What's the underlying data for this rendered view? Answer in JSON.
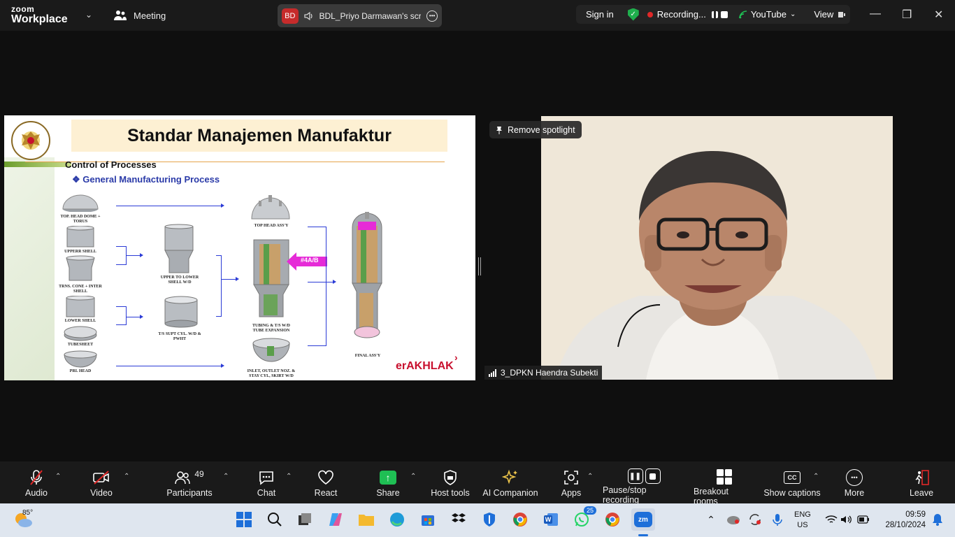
{
  "app": {
    "brand_top": "zoom",
    "brand_bottom": "Workplace"
  },
  "header": {
    "meeting_label": "Meeting",
    "share_initials": "BD",
    "share_name": "BDL_Priyo Darmawan's scree",
    "sign_in": "Sign in",
    "recording": "Recording...",
    "youtube": "YouTube",
    "view": "View"
  },
  "slide": {
    "title": "Standar Manajemen Manufaktur",
    "section": "Control of Processes",
    "subsection": "❖ General Manufacturing Process",
    "parts": {
      "top_head": "TOP. HEAD DOME + TORUS",
      "upper_shell": "UPPERR SHELL",
      "trns_cone": "TRNS. CONE + INTER SHELL",
      "lower_shell": "LOWER SHELL",
      "tubesheet": "TUBESHEET",
      "pri_head": "PRI. HEAD",
      "upper_to_lower": "UPPER TO LOWER SHELL W/D",
      "ts_supt": "T/S SUPT CYL. W/D & PWHT",
      "top_head_assy": "TOP HEAD ASS'Y",
      "tubing": "TUBING & T/S W/D TUBE EXPANSION",
      "inlet": "INLET, OUTLET NOZ. & STAY CYL, SKIRT W/D",
      "final": "FINAL ASS'Y"
    },
    "tag": "#4A/B",
    "footer": "erAKHLAK"
  },
  "video": {
    "spotlight": "Remove spotlight",
    "participant": "3_DPKN Haendra Subekti"
  },
  "toolbar": {
    "audio": "Audio",
    "video": "Video",
    "participants": "Participants",
    "participants_count": "49",
    "chat": "Chat",
    "react": "React",
    "share": "Share",
    "host_tools": "Host tools",
    "ai": "AI Companion",
    "apps": "Apps",
    "recording": "Pause/stop recording",
    "breakout": "Breakout rooms",
    "captions": "Show captions",
    "more": "More",
    "leave": "Leave"
  },
  "taskbar": {
    "weather": "85°",
    "whatsapp_badge": "25",
    "lang_top": "ENG",
    "lang_bottom": "US",
    "time": "09:59",
    "date": "28/10/2024"
  },
  "colors": {
    "accent": "#2a3aa8",
    "record": "#e02828",
    "share": "#1fbf54",
    "leave": "#e02828"
  }
}
